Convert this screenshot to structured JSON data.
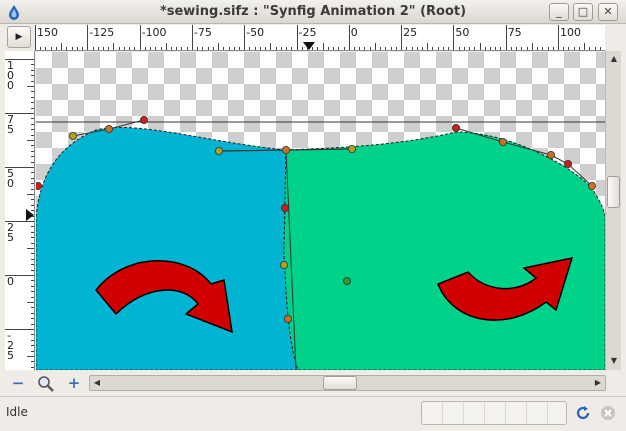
{
  "window": {
    "title": "*sewing.sifz : \"Synfig Animation 2\" (Root)",
    "minimize_glyph": "_",
    "maximize_glyph": "□",
    "close_glyph": "✕"
  },
  "rulers": {
    "corner_glyph": "▶",
    "horizontal_labels": [
      "150",
      "-125",
      "-100",
      "-75",
      "-50",
      "-25",
      "0",
      "25",
      "50",
      "75",
      "100"
    ],
    "vertical_labels": [
      [
        "1",
        "0",
        "0"
      ],
      [
        "7",
        "5"
      ],
      [
        "5",
        "0"
      ],
      [
        "2",
        "5"
      ],
      [
        "0"
      ],
      [
        "-",
        "2",
        "5"
      ]
    ]
  },
  "canvas": {
    "left_shape_color": "#00b4d2",
    "right_shape_color": "#00d28a",
    "arrow_color": "#d00000",
    "arrow_outline_color": "#000000",
    "handle_colors": {
      "red": "#c81e1e",
      "orange": "#c87020",
      "yellow": "#b0a020",
      "green": "#2c9a2c"
    }
  },
  "bottom": {
    "zoom_out_glyph": "−",
    "zoom_fit_icon": "magnifier-icon",
    "zoom_in_glyph": "+"
  },
  "status": {
    "text": "Idle"
  }
}
